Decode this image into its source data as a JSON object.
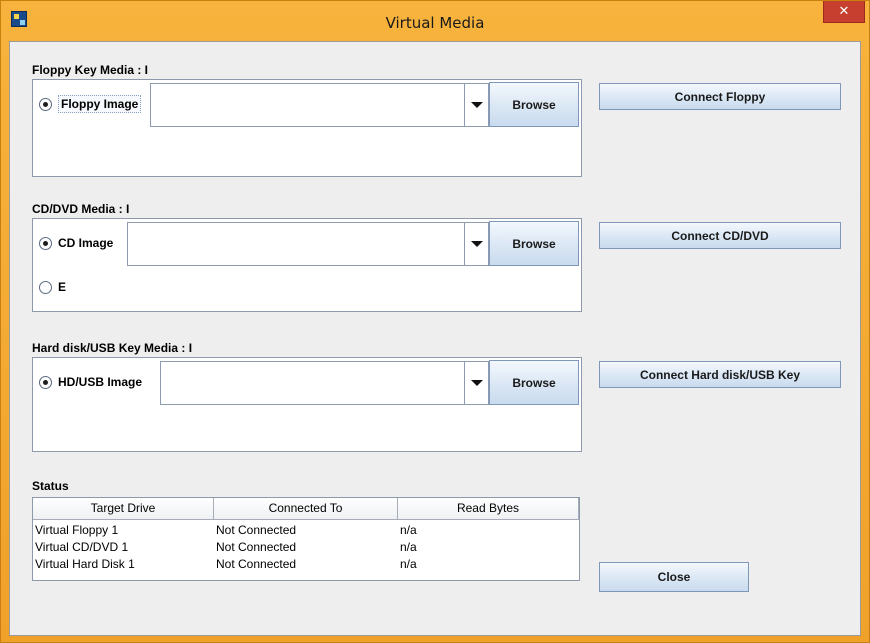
{
  "window": {
    "title": "Virtual Media",
    "close_glyph": "✕"
  },
  "floppy": {
    "group_label": "Floppy Key Media : I",
    "radio_label": "Floppy Image",
    "combo_value": "",
    "browse_label": "Browse",
    "connect_label": "Connect Floppy"
  },
  "cddvd": {
    "group_label": "CD/DVD Media : I",
    "radio_label": "CD Image",
    "radio2_label": "E",
    "combo_value": "",
    "browse_label": "Browse",
    "connect_label": "Connect CD/DVD"
  },
  "harddisk": {
    "group_label": "Hard disk/USB Key Media : I",
    "radio_label": "HD/USB Image",
    "combo_value": "",
    "browse_label": "Browse",
    "connect_label": "Connect Hard disk/USB Key"
  },
  "status": {
    "label": "Status",
    "columns": [
      "Target Drive",
      "Connected To",
      "Read Bytes"
    ],
    "rows": [
      [
        "Virtual Floppy 1",
        "Not Connected",
        "n/a"
      ],
      [
        "Virtual CD/DVD 1",
        "Not Connected",
        "n/a"
      ],
      [
        "Virtual Hard Disk 1",
        "Not Connected",
        "n/a"
      ]
    ]
  },
  "close_label": "Close",
  "colors": {
    "titlebar": "#f0a12a",
    "close_button": "#c7402f",
    "button_border": "#7f98b9"
  }
}
